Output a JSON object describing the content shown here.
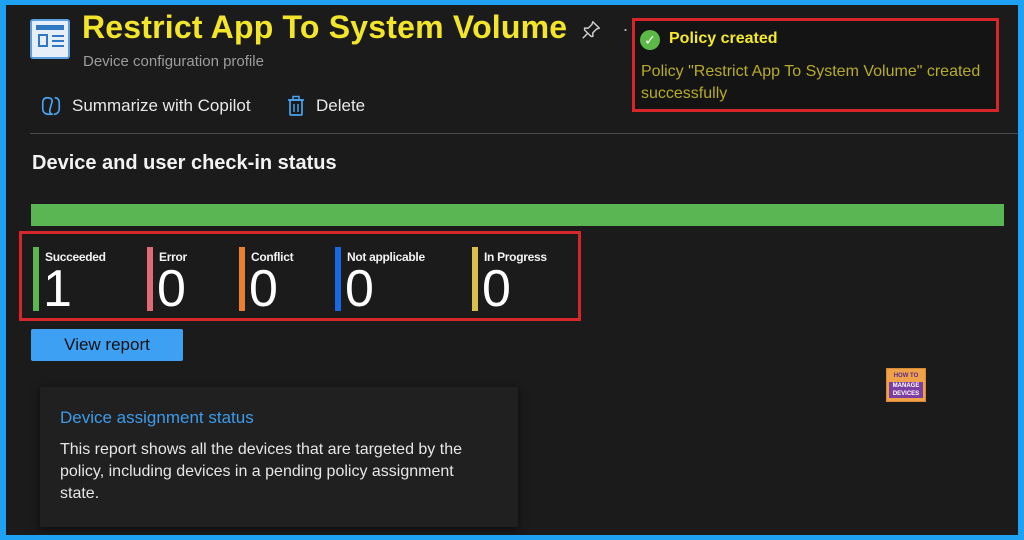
{
  "header": {
    "title": "Restrict App To System Volume",
    "subtitle": "Device configuration profile",
    "more_label": "."
  },
  "toast": {
    "title": "Policy created",
    "message": "Policy \"Restrict App To System Volume\" created successfully"
  },
  "commands": [
    {
      "label": "Summarize with Copilot",
      "icon": "copilot-icon"
    },
    {
      "label": "Delete",
      "icon": "trash-icon"
    }
  ],
  "checkin": {
    "title": "Device and user check-in status",
    "progress_succeeded_fraction": 1.0,
    "stats": [
      {
        "label": "Succeeded",
        "value": "1",
        "color": "#5ab553"
      },
      {
        "label": "Error",
        "value": "0",
        "color": "#e06b74"
      },
      {
        "label": "Conflict",
        "value": "0",
        "color": "#ee7e2f"
      },
      {
        "label": "Not applicable",
        "value": "0",
        "color": "#1868e0"
      },
      {
        "label": "In Progress",
        "value": "0",
        "color": "#d9c14a"
      }
    ],
    "view_report_label": "View report"
  },
  "watermark": {
    "line1": "HOW TO",
    "line2": "MANAGE DEVICES"
  },
  "assignment_card": {
    "title": "Device assignment status",
    "description": "This report shows all the devices that are targeted by the policy, including devices in a pending policy assignment state."
  },
  "colors": {
    "title_highlight": "#f2e52a",
    "toast_border": "#d7262a",
    "progress": "#5ab553",
    "link": "#3d9be9",
    "frame_border": "#1ea1f2"
  }
}
